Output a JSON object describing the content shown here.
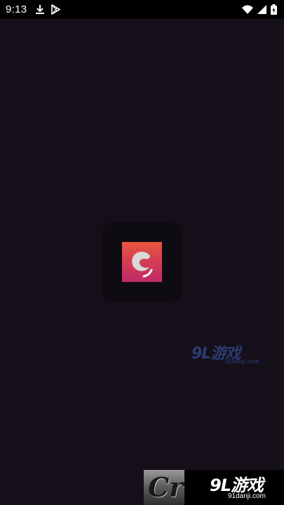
{
  "status_bar": {
    "time": "9:13",
    "left_icons": [
      "download-icon",
      "play-store-icon"
    ],
    "right_icons": [
      "wifi-icon",
      "signal-icon",
      "battery-icon"
    ]
  },
  "splash": {
    "app_icon": "app-logo-icon",
    "colors": {
      "background": "#150f1a",
      "card": "#0f0b12",
      "icon_gradient_top": "#e8573f",
      "icon_gradient_bottom": "#c02a68"
    }
  },
  "watermark": {
    "main": "9L游戏",
    "sub": "91danji.com"
  },
  "banner": {
    "logo_text": "Cr",
    "main": "9L游戏",
    "sub": "91danji.com"
  }
}
